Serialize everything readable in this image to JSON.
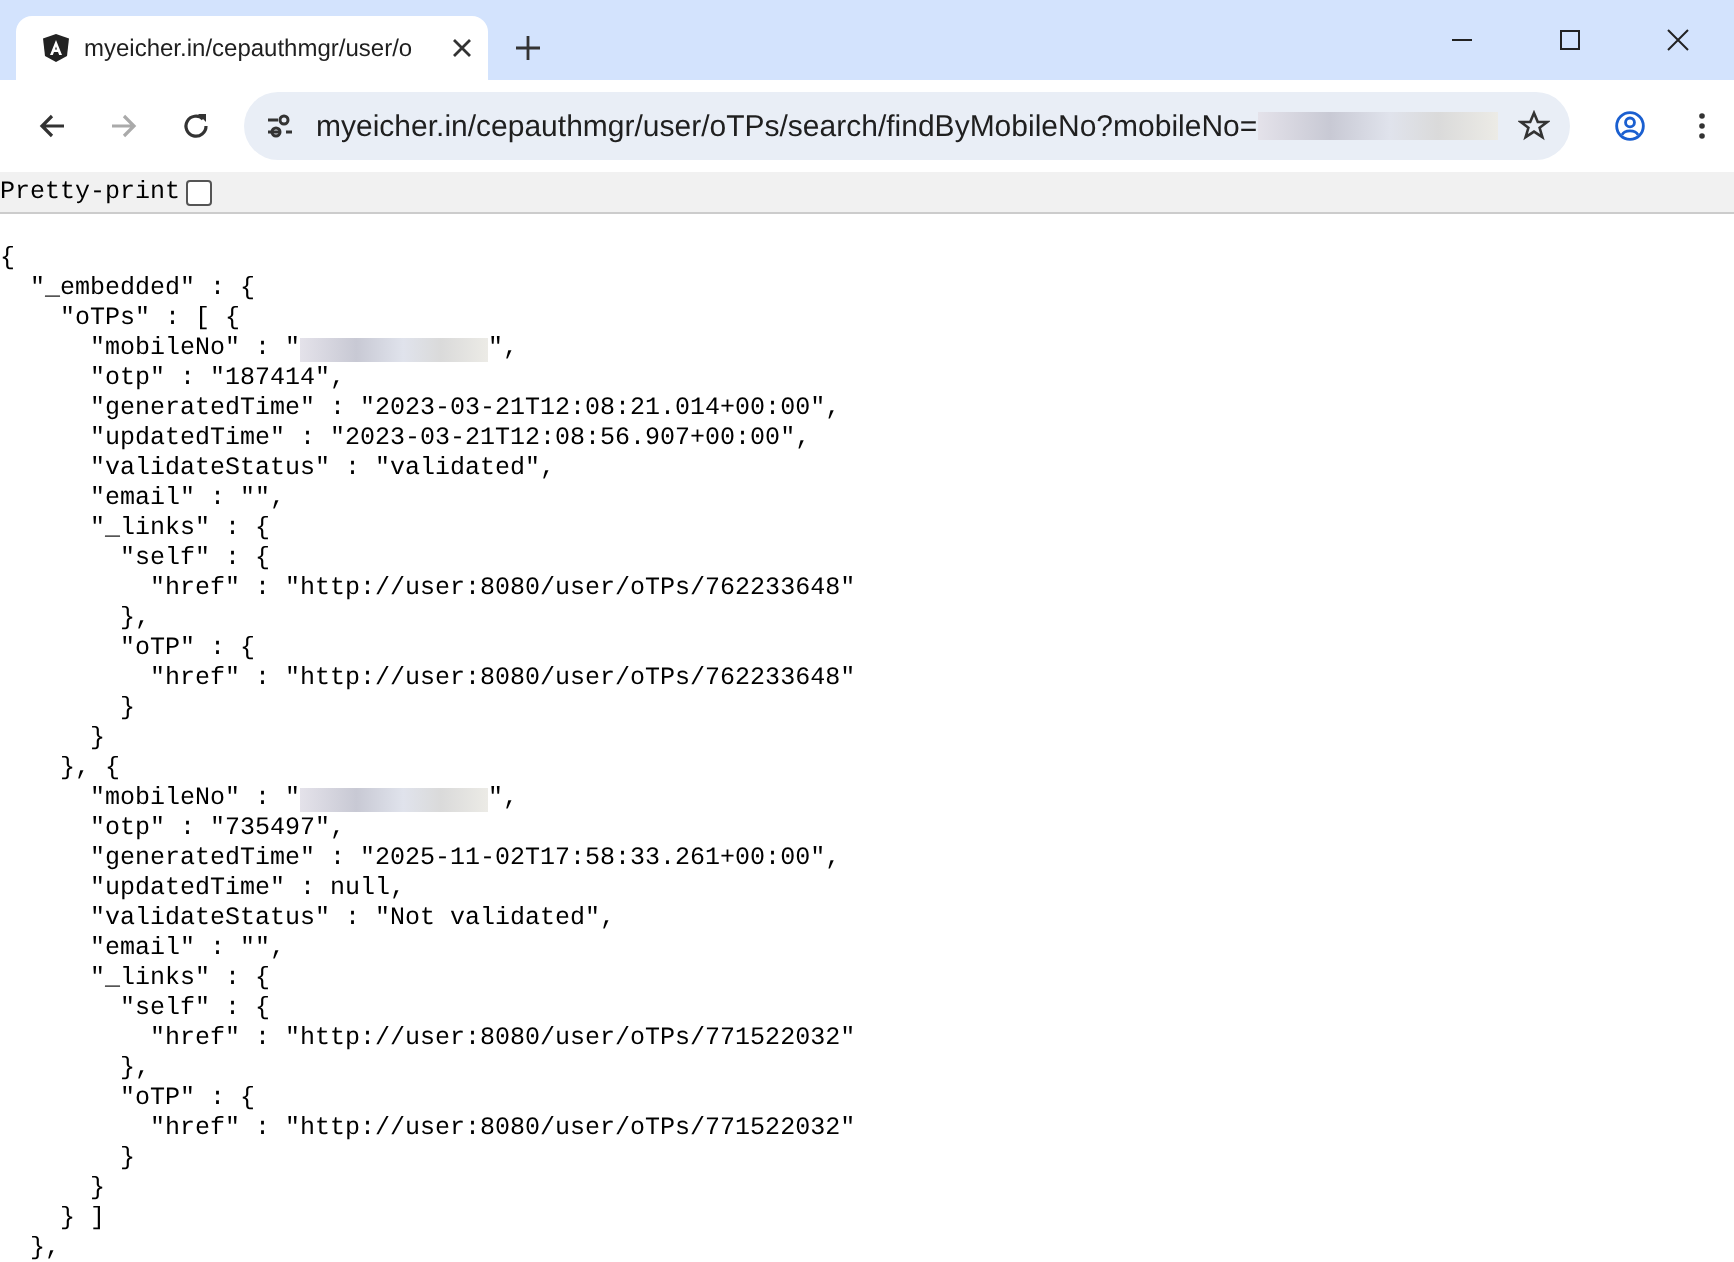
{
  "tab": {
    "title": "myeicher.in/cepauthmgr/user/o",
    "selected": true
  },
  "address_bar": {
    "url": "myeicher.in/cepauthmgr/user/oTPs/search/findByMobileNo?mobileNo=",
    "redacted": true
  },
  "pretty_print": {
    "label": "Pretty-print",
    "checked": false
  },
  "body_lines": [
    {
      "text": "{"
    },
    {
      "text": "  \"_embedded\" : {"
    },
    {
      "text": "    \"oTPs\" : [ {"
    },
    {
      "text": "      \"mobileNo\" : \"",
      "redacted": true,
      "after": "\","
    },
    {
      "text": "      \"otp\" : \"187414\","
    },
    {
      "text": "      \"generatedTime\" : \"2023-03-21T12:08:21.014+00:00\","
    },
    {
      "text": "      \"updatedTime\" : \"2023-03-21T12:08:56.907+00:00\","
    },
    {
      "text": "      \"validateStatus\" : \"validated\","
    },
    {
      "text": "      \"email\" : \"\","
    },
    {
      "text": "      \"_links\" : {"
    },
    {
      "text": "        \"self\" : {"
    },
    {
      "text": "          \"href\" : \"http://user:8080/user/oTPs/762233648\""
    },
    {
      "text": "        },"
    },
    {
      "text": "        \"oTP\" : {"
    },
    {
      "text": "          \"href\" : \"http://user:8080/user/oTPs/762233648\""
    },
    {
      "text": "        }"
    },
    {
      "text": "      }"
    },
    {
      "text": "    }, {"
    },
    {
      "text": "      \"mobileNo\" : \"",
      "redacted": true,
      "after": "\","
    },
    {
      "text": "      \"otp\" : \"735497\","
    },
    {
      "text": "      \"generatedTime\" : \"2025-11-02T17:58:33.261+00:00\","
    },
    {
      "text": "      \"updatedTime\" : null,"
    },
    {
      "text": "      \"validateStatus\" : \"Not validated\","
    },
    {
      "text": "      \"email\" : \"\","
    },
    {
      "text": "      \"_links\" : {"
    },
    {
      "text": "        \"self\" : {"
    },
    {
      "text": "          \"href\" : \"http://user:8080/user/oTPs/771522032\""
    },
    {
      "text": "        },"
    },
    {
      "text": "        \"oTP\" : {"
    },
    {
      "text": "          \"href\" : \"http://user:8080/user/oTPs/771522032\""
    },
    {
      "text": "        }"
    },
    {
      "text": "      }"
    },
    {
      "text": "    } ]"
    },
    {
      "text": "  },"
    }
  ]
}
